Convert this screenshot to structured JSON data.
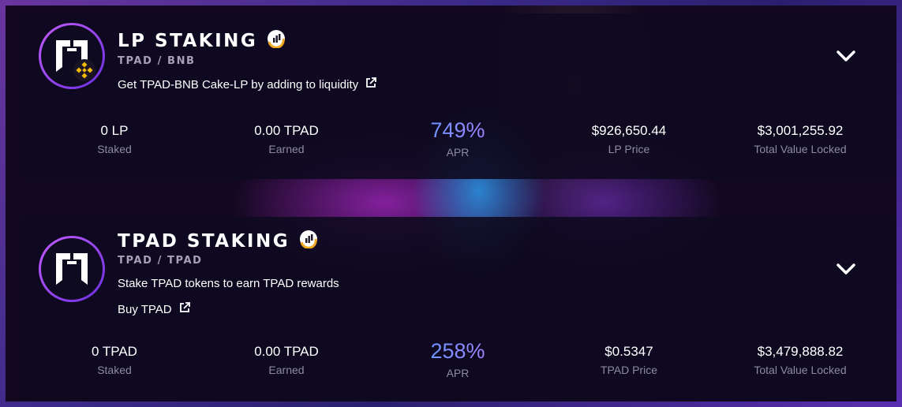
{
  "lp_staking": {
    "title": "LP STAKING",
    "pair": "TPAD / BNB",
    "description": "Get TPAD-BNB Cake-LP by adding to liquidity",
    "stats": {
      "staked_value": "0 LP",
      "staked_label": "Staked",
      "earned_value": "0.00 TPAD",
      "earned_label": "Earned",
      "apr_value": "749%",
      "apr_label": "APR",
      "price_value": "$926,650.44",
      "price_label": "LP Price",
      "tvl_value": "$3,001,255.92",
      "tvl_label": "Total Value Locked"
    }
  },
  "tpad_staking": {
    "title": "TPAD STAKING",
    "pair": "TPAD / TPAD",
    "description": "Stake TPAD tokens to earn TPAD rewards",
    "buy_label": "Buy TPAD",
    "stats": {
      "staked_value": "0 TPAD",
      "staked_label": "Staked",
      "earned_value": "0.00 TPAD",
      "earned_label": "Earned",
      "apr_value": "258%",
      "apr_label": "APR",
      "price_value": "$0.5347",
      "price_label": "TPAD Price",
      "tvl_value": "$3,479,888.82",
      "tvl_label": "Total Value Locked"
    }
  },
  "colors": {
    "accent_purple": "#c55cff",
    "apr_gradient_start": "#34a4ff",
    "apr_gradient_end": "#d774ff",
    "badge_yellow": "#f0b90b",
    "label_gray": "#8e8aa2"
  },
  "icons": {
    "logo": "tpad-logo-icon",
    "bnb": "bnb-icon",
    "verified": "verified-chart-icon",
    "external_link": "external-link-icon",
    "expand": "chevron-down-icon"
  }
}
